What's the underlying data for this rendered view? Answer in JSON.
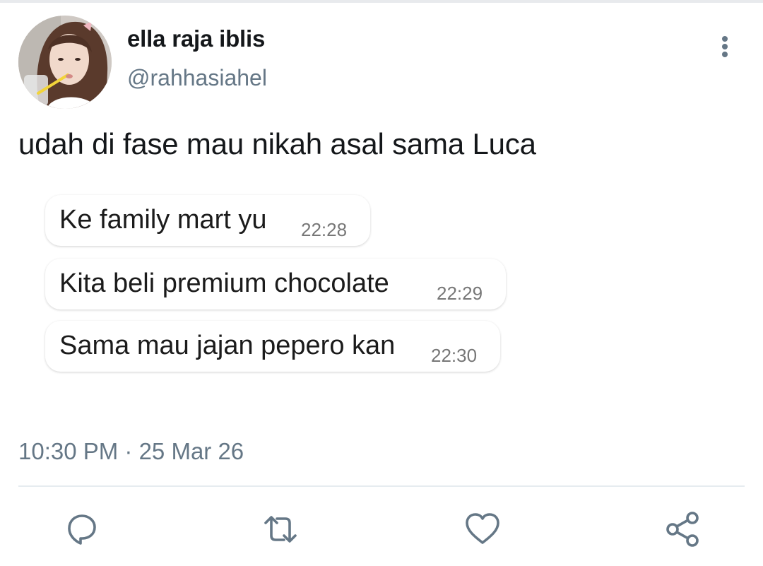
{
  "tweet": {
    "display_name": "ella raja iblis",
    "handle": "@rahhasiahel",
    "text": "udah di fase mau nikah asal sama Luca",
    "timestamp": "10:30 PM · 25 Mar 26"
  },
  "chat_image": {
    "messages": [
      {
        "text": "Ke family mart yu",
        "time": "22:28"
      },
      {
        "text": "Kita beli premium chocolate",
        "time": "22:29"
      },
      {
        "text": "Sama mau jajan pepero kan",
        "time": "22:30"
      }
    ]
  },
  "icons": {
    "more": "more-vertical-icon",
    "reply": "reply-icon",
    "retweet": "retweet-icon",
    "like": "heart-icon",
    "share": "share-icon"
  },
  "colors": {
    "icon": "#657786",
    "text": "#14171a",
    "secondary": "#657786"
  }
}
